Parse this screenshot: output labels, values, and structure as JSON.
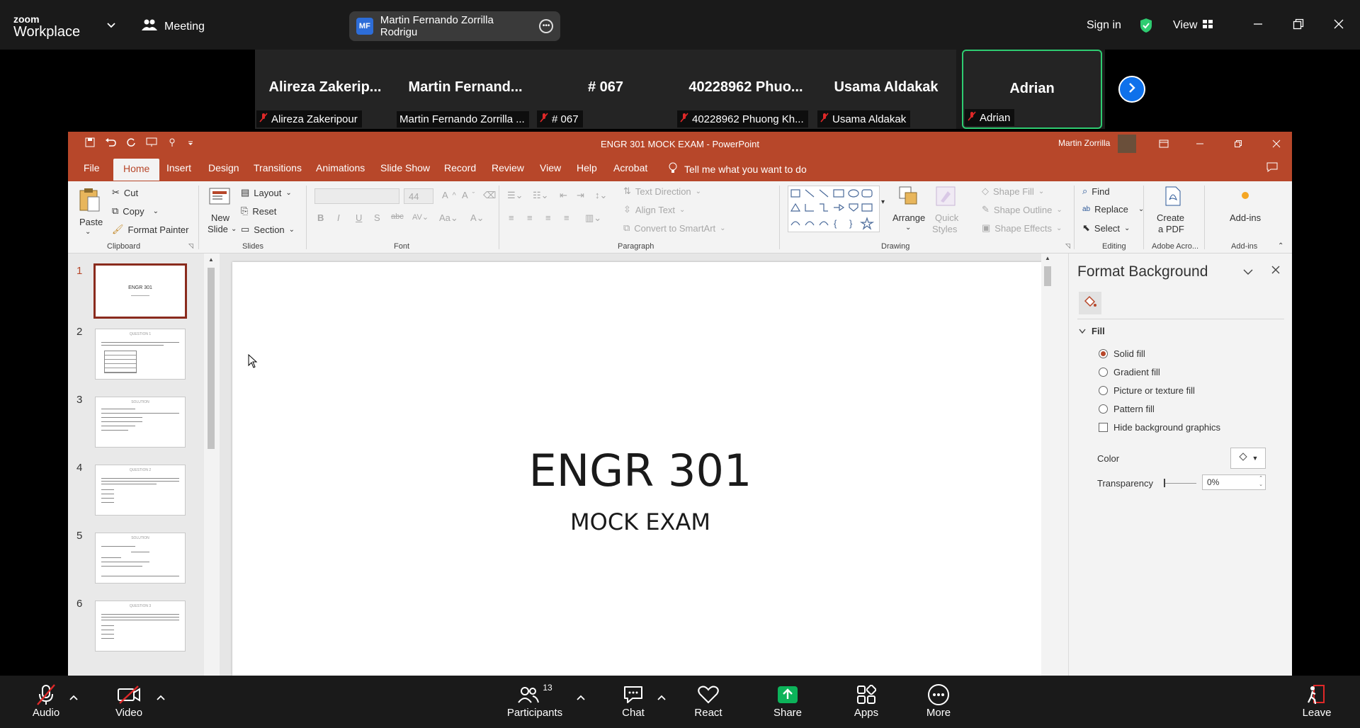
{
  "zoom": {
    "logo_line1": "zoom",
    "logo_line2": "Workplace",
    "meeting_label": "Meeting",
    "sharer_initials": "MF",
    "sharer_name": "Martin Fernando Zorrilla Rodrigu",
    "sign_in": "Sign in",
    "view_label": "View",
    "participants": [
      {
        "name": "Alireza  Zakerip...",
        "label": "Alireza Zakeripour",
        "active": false
      },
      {
        "name": "Martin  Fernand...",
        "label": "Martin Fernando Zorrilla ...",
        "active": false
      },
      {
        "name": "# 067",
        "label": "# 067",
        "active": false
      },
      {
        "name": "40228962  Phuo...",
        "label": "40228962 Phuong Kh...",
        "active": false
      },
      {
        "name": "Usama Aldakak",
        "label": "Usama Aldakak",
        "active": false
      },
      {
        "name": "Adrian",
        "label": "Adrian",
        "active": true
      }
    ],
    "toolbar": {
      "audio": "Audio",
      "video": "Video",
      "participants": "Participants",
      "participants_count": "13",
      "chat": "Chat",
      "react": "React",
      "share": "Share",
      "apps": "Apps",
      "more": "More",
      "leave": "Leave"
    },
    "colors": {
      "active_tile": "#2ecc71",
      "share_green": "#0cb35a",
      "accent_blue": "#0e71eb",
      "muted_red": "#e02828"
    }
  },
  "ppt": {
    "title": "ENGR 301 MOCK EXAM  -  PowerPoint",
    "user": "Martin Zorrilla",
    "tabs": [
      "File",
      "Home",
      "Insert",
      "Design",
      "Transitions",
      "Animations",
      "Slide Show",
      "Record",
      "Review",
      "View",
      "Help",
      "Acrobat"
    ],
    "tell_me": "Tell me what you want to do",
    "ribbon": {
      "clipboard": {
        "paste": "Paste",
        "cut": "Cut",
        "copy": "Copy",
        "format_painter": "Format Painter",
        "label": "Clipboard"
      },
      "slides": {
        "new_slide_1": "New",
        "new_slide_2": "Slide",
        "layout": "Layout",
        "reset": "Reset",
        "section": "Section",
        "label": "Slides"
      },
      "font": {
        "size": "44",
        "label": "Font"
      },
      "paragraph": {
        "text_direction": "Text Direction",
        "align_text": "Align Text",
        "convert_smartart": "Convert to SmartArt",
        "label": "Paragraph"
      },
      "drawing": {
        "arrange": "Arrange",
        "quick_styles_1": "Quick",
        "quick_styles_2": "Styles",
        "shape_fill": "Shape Fill",
        "shape_outline": "Shape Outline",
        "shape_effects": "Shape Effects",
        "label": "Drawing"
      },
      "editing": {
        "find": "Find",
        "replace": "Replace",
        "select": "Select",
        "label": "Editing"
      },
      "adobe": {
        "create_1": "Create",
        "create_2": "a PDF",
        "label": "Adobe Acro..."
      },
      "addins": {
        "addins": "Add-ins",
        "label": "Add-ins"
      }
    },
    "thumbnails": [
      {
        "num": "1",
        "title": "ENGR 301",
        "selected": true
      },
      {
        "num": "2",
        "title": "QUESTION 1",
        "selected": false
      },
      {
        "num": "3",
        "title": "SOLUTION",
        "selected": false
      },
      {
        "num": "4",
        "title": "QUESTION 2",
        "selected": false
      },
      {
        "num": "5",
        "title": "SOLUTION",
        "selected": false
      },
      {
        "num": "6",
        "title": "QUESTION 3",
        "selected": false
      }
    ],
    "slide": {
      "title": "ENGR 301",
      "subtitle": "MOCK EXAM"
    },
    "format_background": {
      "title": "Format Background",
      "section": "Fill",
      "options": [
        {
          "label": "Solid fill",
          "selected": true
        },
        {
          "label": "Gradient fill",
          "selected": false
        },
        {
          "label": "Picture or texture fill",
          "selected": false
        },
        {
          "label": "Pattern fill",
          "selected": false
        }
      ],
      "hide_graphics": "Hide background graphics",
      "color_label": "Color",
      "transparency_label": "Transparency",
      "transparency_value": "0%"
    },
    "colors": {
      "brand": "#b7472a"
    }
  }
}
